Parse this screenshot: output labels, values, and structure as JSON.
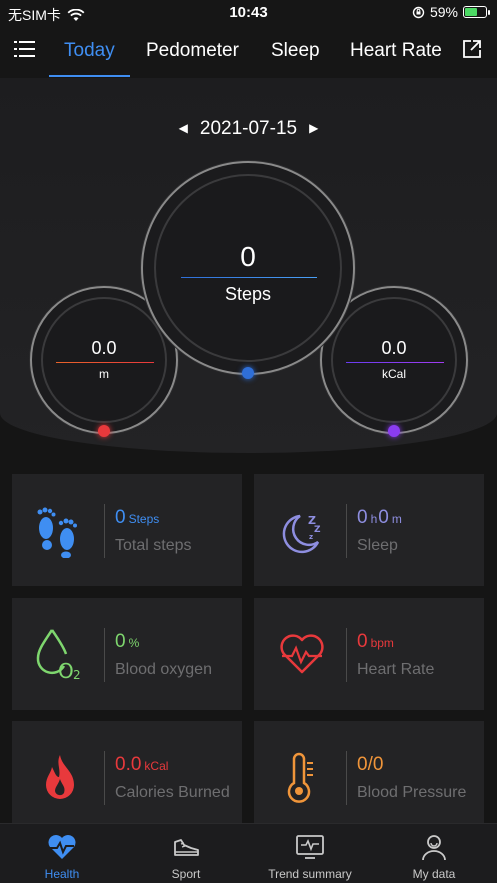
{
  "status_bar": {
    "carrier": "无SIM卡",
    "time": "10:43",
    "battery": "59%",
    "battery_level": 0.59
  },
  "nav": {
    "tabs": [
      {
        "label": "Today",
        "active": true
      },
      {
        "label": "Pedometer",
        "active": false
      },
      {
        "label": "Sleep",
        "active": false
      },
      {
        "label": "Heart Rate",
        "active": false
      }
    ]
  },
  "dashboard": {
    "date": "2021-07-15",
    "steps": {
      "value": "0",
      "unit": "Steps"
    },
    "distance": {
      "value": "0.0",
      "unit": "m"
    },
    "calories": {
      "value": "0.0",
      "unit": "kCal"
    }
  },
  "cards": [
    {
      "icon": "footprints-icon",
      "value": "0",
      "unit": "Steps",
      "label": "Total steps",
      "color": "#3f8ef2"
    },
    {
      "icon": "moon-sleep-icon",
      "value_h": "0",
      "unit_h": "h",
      "value_m": "0",
      "unit_m": "m",
      "label": "Sleep",
      "color": "#8e8ee0"
    },
    {
      "icon": "blood-drop-o2-icon",
      "value": "0",
      "unit": "%",
      "label": "Blood oxygen",
      "color": "#7ed66e"
    },
    {
      "icon": "heart-pulse-icon",
      "value": "0",
      "unit": "bpm",
      "label": "Heart Rate",
      "color": "#e8393c"
    },
    {
      "icon": "flame-icon",
      "value": "0.0",
      "unit": "kCal",
      "label": "Calories Burned",
      "color": "#e8393c"
    },
    {
      "icon": "thermometer-icon",
      "value": "0/0",
      "label": "Blood Pressure",
      "color": "#f0953a"
    }
  ],
  "bottom_nav": [
    {
      "label": "Health",
      "active": true
    },
    {
      "label": "Sport",
      "active": false
    },
    {
      "label": "Trend summary",
      "active": false
    },
    {
      "label": "My data",
      "active": false
    }
  ],
  "colors": {
    "accent": "#3f8ef2",
    "red": "#e8393c",
    "purple": "#8a3cf0"
  }
}
